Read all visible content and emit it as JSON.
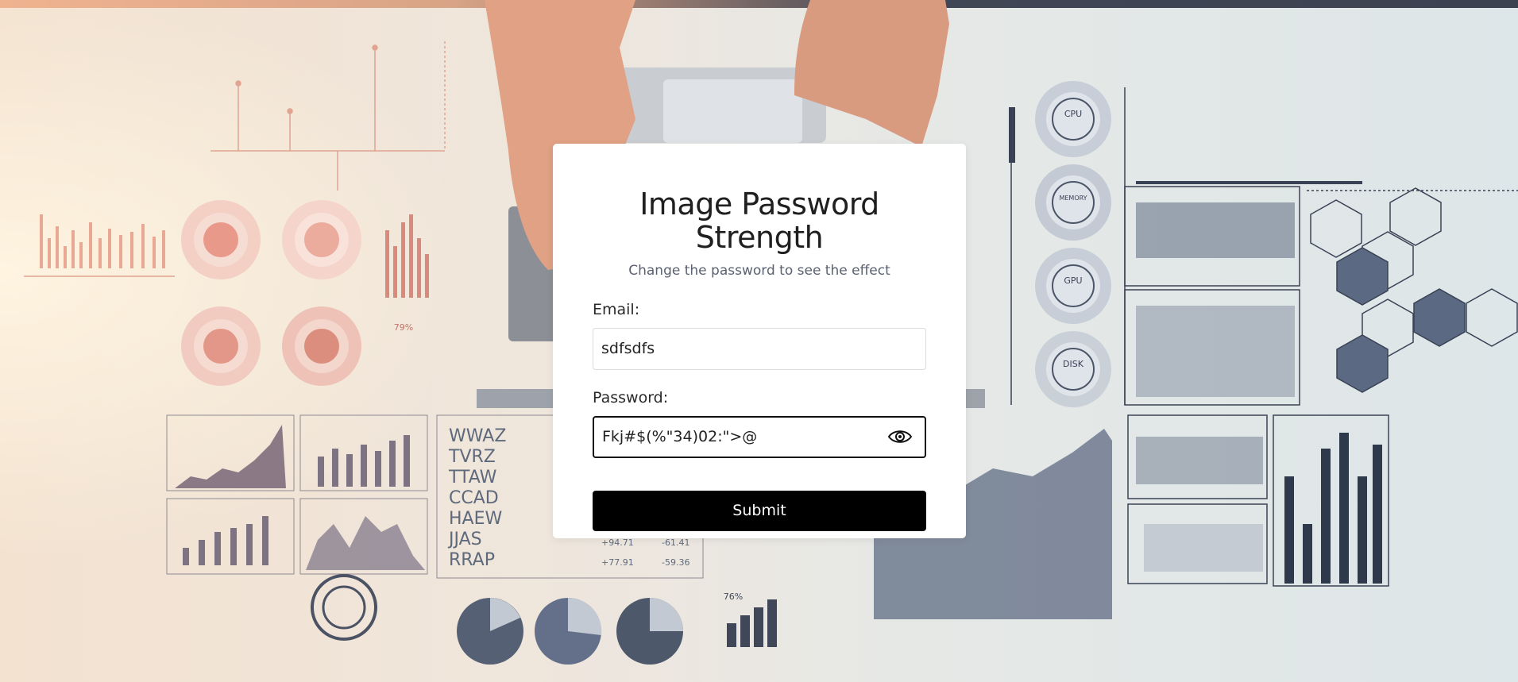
{
  "page": {
    "title": "Image Password Strength",
    "subtitle": "Change the password to see the effect"
  },
  "form": {
    "email_label": "Email:",
    "email_value": "sdfsdfs",
    "password_label": "Password:",
    "password_value": "Fkj#$(%\"34)02:\">@",
    "submit_label": "Submit"
  },
  "background": {
    "image_text": [
      "WWAZ",
      "TVRZ",
      "TTAW",
      "CCAD",
      "HAEW",
      "JJAS",
      "RRAP"
    ],
    "gauges": [
      "CPU",
      "MEMORY",
      "GPU",
      "DISK"
    ],
    "stats": [
      "+94.71",
      "-61.41",
      "+77.91",
      "-59.36"
    ],
    "percent_a": "79%",
    "percent_b": "76%"
  },
  "colors": {
    "button_bg": "#000000",
    "card_bg": "#ffffff",
    "focus_border": "#111111"
  }
}
